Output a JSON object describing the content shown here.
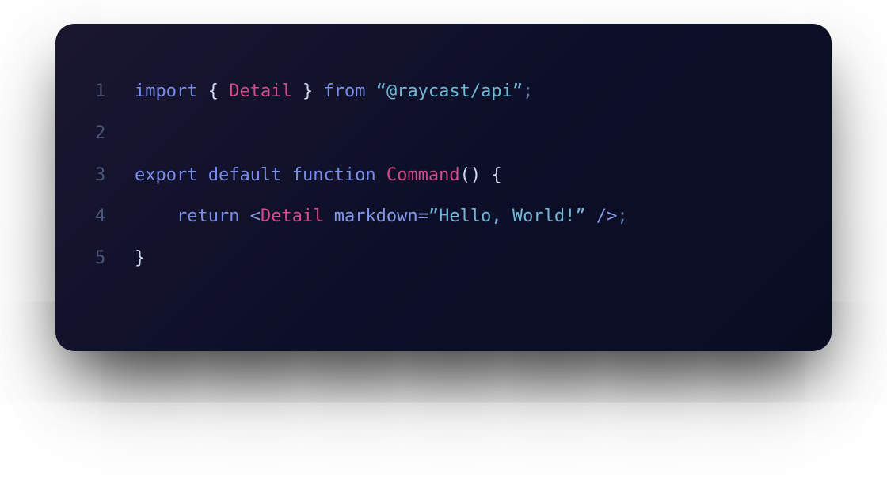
{
  "code": {
    "lines": [
      {
        "num": "1",
        "tokens": [
          {
            "cls": "tok-keyword",
            "text": "import"
          },
          {
            "cls": "tok-plain",
            "text": " "
          },
          {
            "cls": "tok-brace",
            "text": "{ "
          },
          {
            "cls": "tok-classname",
            "text": "Detail"
          },
          {
            "cls": "tok-brace",
            "text": " }"
          },
          {
            "cls": "tok-plain",
            "text": " "
          },
          {
            "cls": "tok-from",
            "text": "from"
          },
          {
            "cls": "tok-plain",
            "text": " "
          },
          {
            "cls": "tok-string",
            "text": "“@raycast/api”"
          },
          {
            "cls": "tok-punct",
            "text": ";"
          }
        ]
      },
      {
        "num": "2",
        "tokens": []
      },
      {
        "num": "3",
        "tokens": [
          {
            "cls": "tok-keyword",
            "text": "export"
          },
          {
            "cls": "tok-plain",
            "text": " "
          },
          {
            "cls": "tok-keyword",
            "text": "default"
          },
          {
            "cls": "tok-plain",
            "text": " "
          },
          {
            "cls": "tok-keyword",
            "text": "function"
          },
          {
            "cls": "tok-plain",
            "text": " "
          },
          {
            "cls": "tok-funcname",
            "text": "Command"
          },
          {
            "cls": "tok-brace",
            "text": "()"
          },
          {
            "cls": "tok-plain",
            "text": " "
          },
          {
            "cls": "tok-brace",
            "text": "{"
          }
        ]
      },
      {
        "num": "4",
        "tokens": [
          {
            "cls": "tok-plain",
            "text": "    "
          },
          {
            "cls": "tok-keyword",
            "text": "return"
          },
          {
            "cls": "tok-plain",
            "text": " "
          },
          {
            "cls": "tok-jsx-tag",
            "text": "<"
          },
          {
            "cls": "tok-jsx-name",
            "text": "Detail"
          },
          {
            "cls": "tok-plain",
            "text": " "
          },
          {
            "cls": "tok-jsx-attr",
            "text": "markdown"
          },
          {
            "cls": "tok-jsx-tag",
            "text": "="
          },
          {
            "cls": "tok-jsx-string",
            "text": "”Hello, World!”"
          },
          {
            "cls": "tok-plain",
            "text": " "
          },
          {
            "cls": "tok-jsx-tag",
            "text": "/>"
          },
          {
            "cls": "tok-punct",
            "text": ";"
          }
        ]
      },
      {
        "num": "5",
        "tokens": [
          {
            "cls": "tok-brace",
            "text": "}"
          }
        ]
      }
    ]
  }
}
